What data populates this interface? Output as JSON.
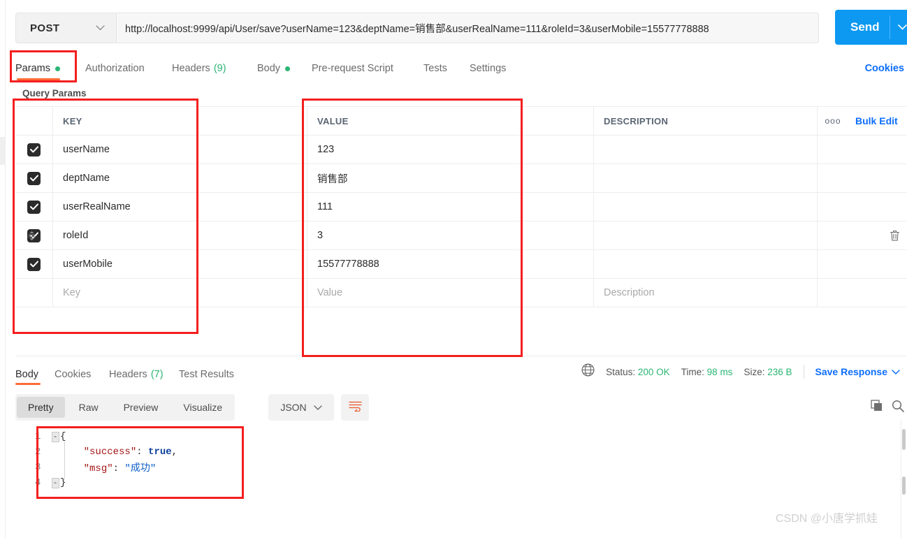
{
  "request": {
    "method": "POST",
    "url": "http://localhost:9999/api/User/save?userName=123&deptName=销售部&userRealName=111&roleId=3&userMobile=15577778888",
    "send_label": "Send",
    "tabs": [
      {
        "label": "Params",
        "dot": true,
        "count": "",
        "active": true
      },
      {
        "label": "Authorization",
        "dot": false,
        "count": "",
        "active": false
      },
      {
        "label": "Headers",
        "dot": false,
        "count": "(9)",
        "active": false
      },
      {
        "label": "Body",
        "dot": true,
        "count": "",
        "active": false
      },
      {
        "label": "Pre-request Script",
        "dot": false,
        "count": "",
        "active": false
      },
      {
        "label": "Tests",
        "dot": false,
        "count": "",
        "active": false
      },
      {
        "label": "Settings",
        "dot": false,
        "count": "",
        "active": false
      }
    ],
    "cookies_link": "Cookies"
  },
  "query_params": {
    "section_title": "Query Params",
    "headers": {
      "key": "KEY",
      "value": "VALUE",
      "description": "DESCRIPTION"
    },
    "bulk_edit_label": "Bulk Edit",
    "more_icon": "ooo",
    "rows": [
      {
        "checked": true,
        "key": "userName",
        "value": "123",
        "description": ""
      },
      {
        "checked": true,
        "key": "deptName",
        "value": "销售部",
        "description": ""
      },
      {
        "checked": true,
        "key": "userRealName",
        "value": "111",
        "description": ""
      },
      {
        "checked": true,
        "key": "roleId",
        "value": "3",
        "description": ""
      },
      {
        "checked": true,
        "key": "userMobile",
        "value": "15577778888",
        "description": ""
      }
    ],
    "empty_row": {
      "key": "Key",
      "value": "Value",
      "description": "Description"
    }
  },
  "response": {
    "tabs": [
      {
        "label": "Body",
        "count": "",
        "active": true
      },
      {
        "label": "Cookies",
        "count": "",
        "active": false
      },
      {
        "label": "Headers",
        "count": "(7)",
        "active": false
      },
      {
        "label": "Test Results",
        "count": "",
        "active": false
      }
    ],
    "status": {
      "status_label": "Status:",
      "status_value": "200 OK",
      "time_label": "Time:",
      "time_value": "98 ms",
      "size_label": "Size:",
      "size_value": "236 B",
      "save_response_label": "Save Response"
    },
    "viewer_tabs": [
      {
        "label": "Pretty",
        "active": true
      },
      {
        "label": "Raw",
        "active": false
      },
      {
        "label": "Preview",
        "active": false
      },
      {
        "label": "Visualize",
        "active": false
      }
    ],
    "format": "JSON",
    "body_lines": [
      {
        "no": "1",
        "fold": "-",
        "segments": [
          {
            "t": "{",
            "c": "k-pun"
          }
        ]
      },
      {
        "no": "2",
        "fold": "",
        "segments": [
          {
            "t": "    ",
            "c": "k-pun"
          },
          {
            "t": "\"success\"",
            "c": "k-str"
          },
          {
            "t": ": ",
            "c": "k-pun"
          },
          {
            "t": "true",
            "c": "k-bool"
          },
          {
            "t": ",",
            "c": "k-pun"
          }
        ]
      },
      {
        "no": "3",
        "fold": "",
        "segments": [
          {
            "t": "    ",
            "c": "k-pun"
          },
          {
            "t": "\"msg\"",
            "c": "k-str"
          },
          {
            "t": ": ",
            "c": "k-pun"
          },
          {
            "t": "\"成功\"",
            "c": "k-val"
          }
        ]
      },
      {
        "no": "4",
        "fold": "-",
        "segments": [
          {
            "t": "}",
            "c": "k-pun"
          }
        ]
      }
    ]
  },
  "watermark": "CSDN @小唐学抓娃",
  "colors": {
    "accent_orange": "#ff6c37",
    "send_blue": "#0d99f2",
    "link_blue": "#0d6efd",
    "success_green": "#2bb673",
    "annotation_red": "#f41f1f"
  }
}
